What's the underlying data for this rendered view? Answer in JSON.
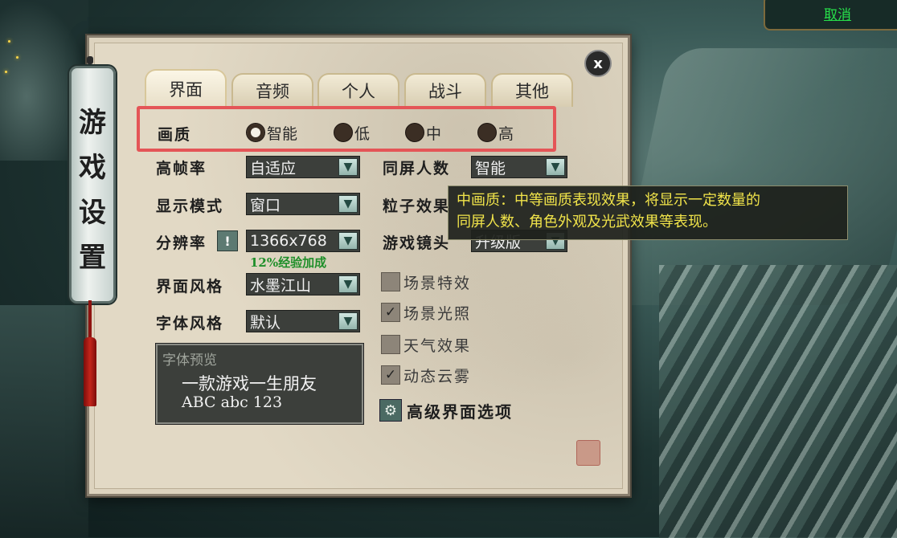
{
  "top_right": {
    "cancel_label": "取消"
  },
  "window": {
    "title": "游戏设置",
    "close_label": "x"
  },
  "tabs": [
    {
      "label": "界面",
      "active": true
    },
    {
      "label": "音频",
      "active": false
    },
    {
      "label": "个人",
      "active": false
    },
    {
      "label": "战斗",
      "active": false
    },
    {
      "label": "其他",
      "active": false
    }
  ],
  "quality": {
    "label": "画质",
    "options": [
      "智能",
      "低",
      "中",
      "高"
    ],
    "selected": "智能"
  },
  "left_settings": {
    "fps": {
      "label": "高帧率",
      "value": "自适应"
    },
    "display_mode": {
      "label": "显示模式",
      "value": "窗口"
    },
    "resolution": {
      "label": "分辨率",
      "value": "1366x768",
      "info_icon": "!",
      "bonus": "12%经验加成"
    },
    "ui_style": {
      "label": "界面风格",
      "value": "水墨江山"
    },
    "font_style": {
      "label": "字体风格",
      "value": "默认"
    }
  },
  "right_settings": {
    "player_count": {
      "label": "同屏人数",
      "value": "智能"
    },
    "particle": {
      "label": "粒子效果"
    },
    "camera": {
      "label": "游戏镜头",
      "value": "升级版"
    }
  },
  "font_preview": {
    "title": "字体预览",
    "line1": "一款游戏一生朋友",
    "line2": "ABC abc 123"
  },
  "checkboxes": [
    {
      "label": "场景特效",
      "checked": false
    },
    {
      "label": "场景光照",
      "checked": true
    },
    {
      "label": "天气效果",
      "checked": false
    },
    {
      "label": "动态云雾",
      "checked": true
    }
  ],
  "advanced_button": {
    "label": "高级界面选项",
    "icon": "gear-icon"
  },
  "tooltip": {
    "line1": "中画质：中等画质表现效果，将显示一定数量的",
    "line2": "同屏人数、角色外观及光武效果等表现。"
  },
  "colors": {
    "highlight": "#e45557",
    "tooltip_text": "#f1e44a",
    "bonus_text": "#1f8f2a",
    "cancel_link": "#27e04a"
  }
}
